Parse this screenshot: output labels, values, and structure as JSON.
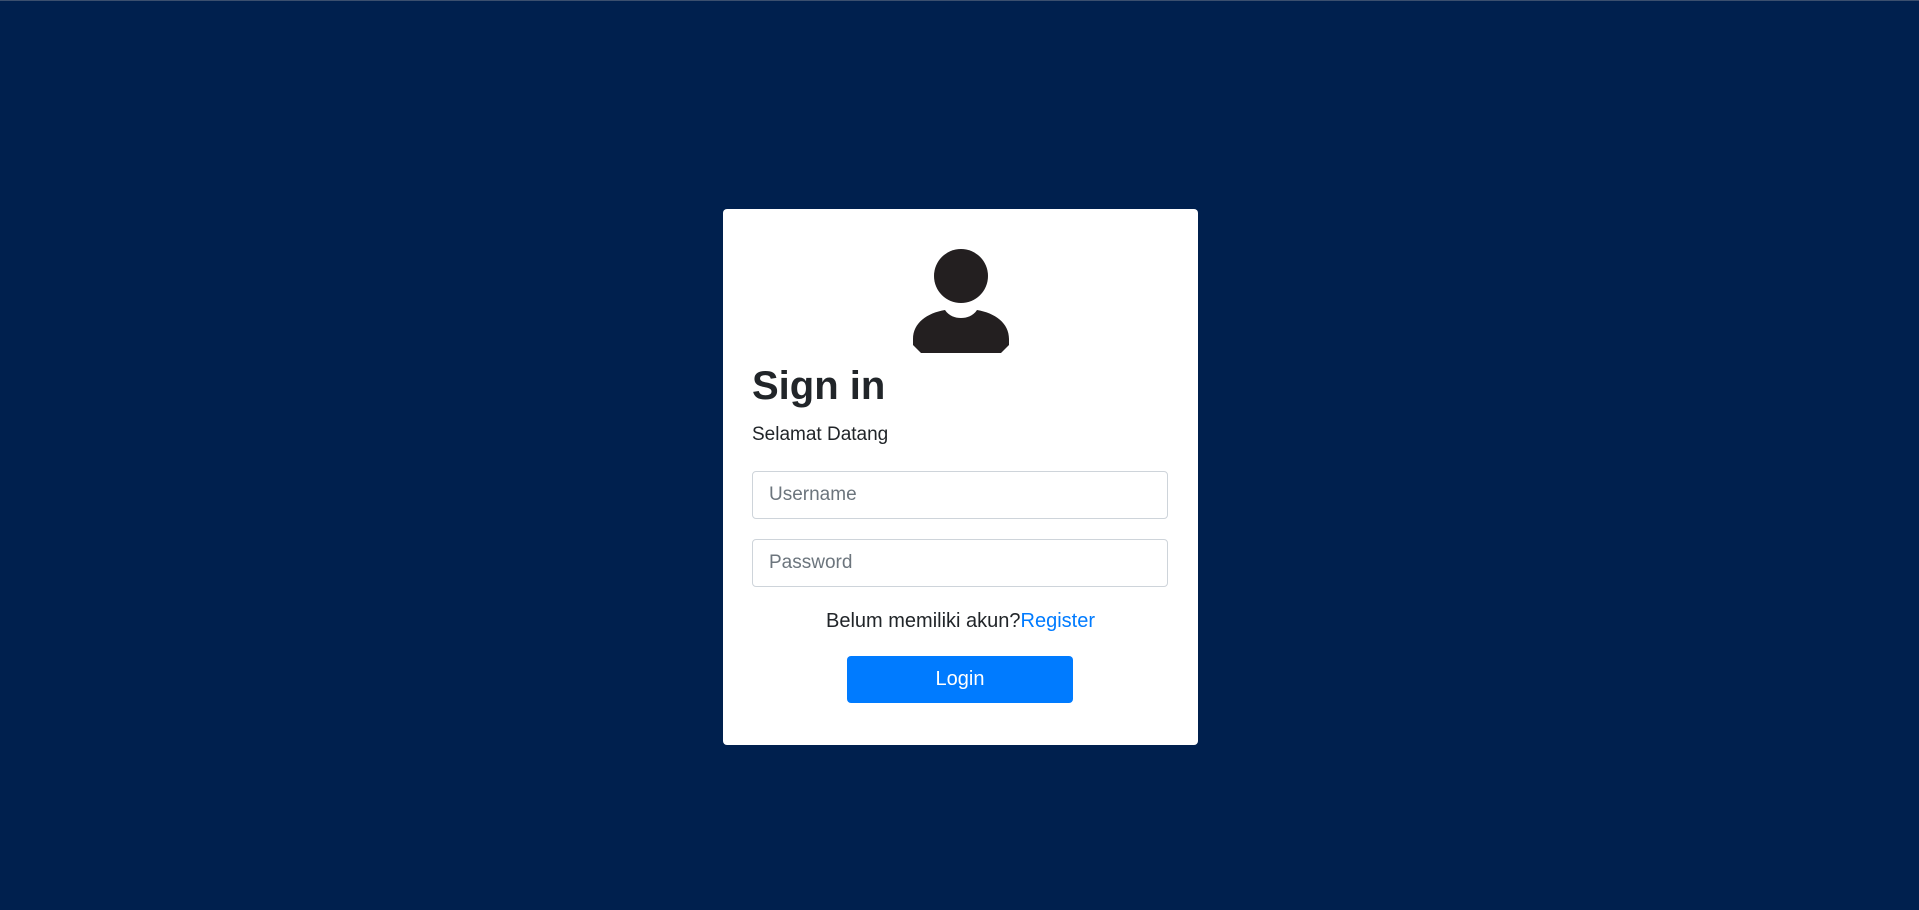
{
  "login_card": {
    "title": "Sign in",
    "subtitle": "Selamat Datang",
    "username_placeholder": "Username",
    "password_placeholder": "Password",
    "register_prompt": "Belum memiliki akun?",
    "register_link": "Register",
    "login_button": "Login",
    "avatar_icon": "user-icon"
  },
  "colors": {
    "background": "#00204e",
    "card": "#ffffff",
    "accent": "#007bff",
    "text": "#212529"
  }
}
